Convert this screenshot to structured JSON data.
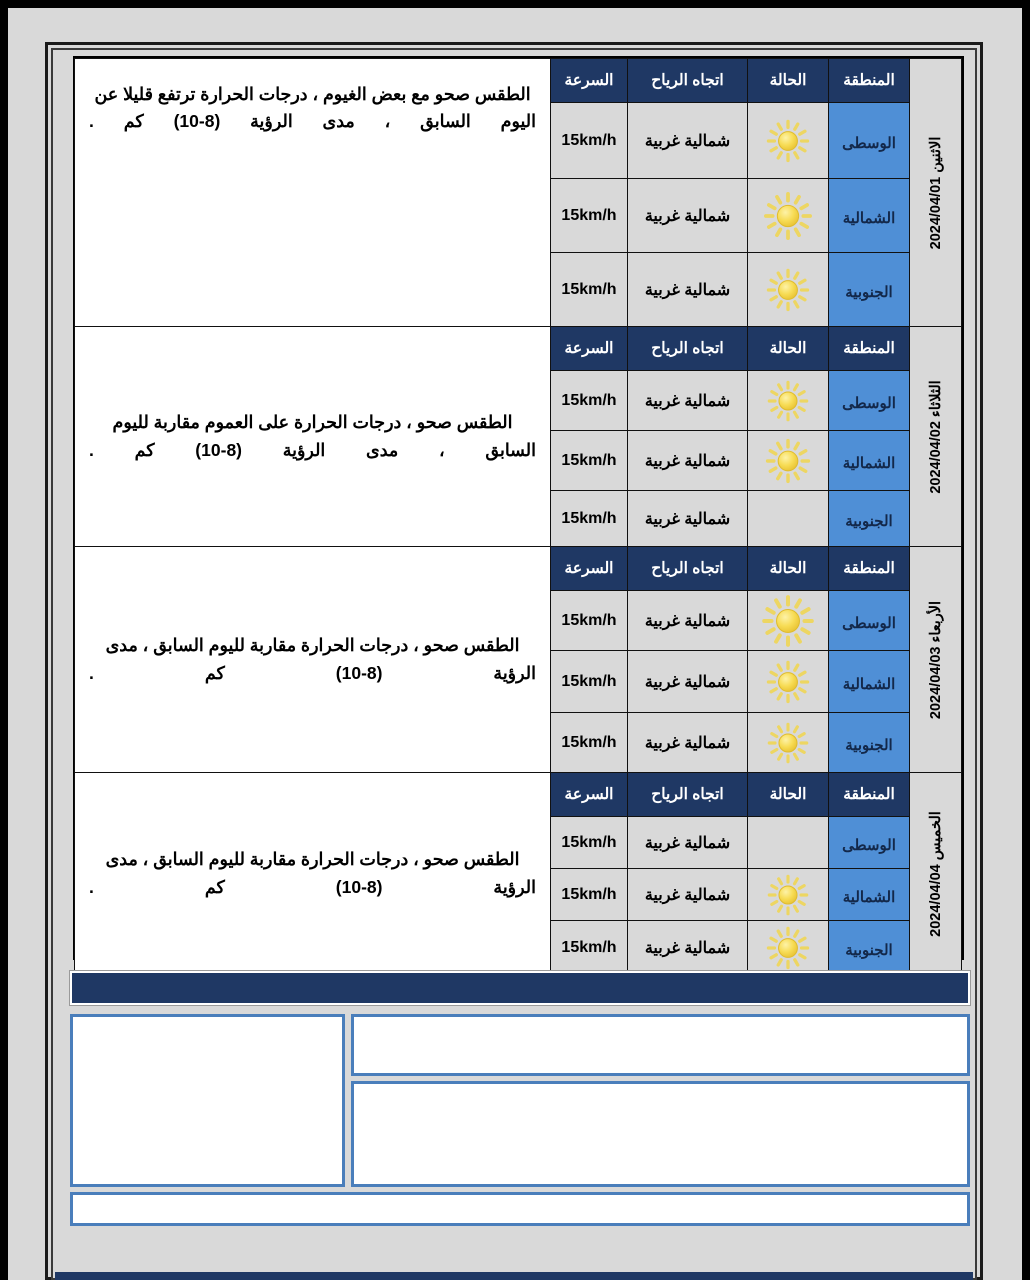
{
  "table": {
    "headers": {
      "region": "المنطقة",
      "condition": "الحالة",
      "wind_direction": "اتجاه الرياح",
      "speed": "السرعة"
    },
    "groups": [
      {
        "date": "الاثنين 2024/04/01",
        "summary": "الطقس صحو مع بعض الغيوم ، درجات الحرارة ترتفع قليلا عن اليوم السابق ، مدى الرؤية (8-10) كم .",
        "rows": [
          {
            "region": "الوسطى",
            "condition": "sun-icon",
            "wind_direction": "شمالية غربية",
            "speed": "15km/h"
          },
          {
            "region": "الشمالية",
            "condition": "sun-icon",
            "wind_direction": "شمالية غربية",
            "speed": "15km/h"
          },
          {
            "region": "الجنوبية",
            "condition": "sun-icon",
            "wind_direction": "شمالية غربية",
            "speed": "15km/h"
          }
        ]
      },
      {
        "date": "الثلاثاء 2024/04/02",
        "summary": "الطقس صحو  ، درجات الحرارة على العموم مقاربة لليوم السابق ، مدى الرؤية (8-10) كم .",
        "rows": [
          {
            "region": "الوسطى",
            "condition": "sun-icon",
            "wind_direction": "شمالية غربية",
            "speed": "15km/h"
          },
          {
            "region": "الشمالية",
            "condition": "sun-icon",
            "wind_direction": "شمالية غربية",
            "speed": "15km/h"
          },
          {
            "region": "الجنوبية",
            "condition": "",
            "wind_direction": "شمالية غربية",
            "speed": "15km/h"
          }
        ]
      },
      {
        "date": "الأربعاء 2024/04/03",
        "summary": "الطقس صحو  ، درجات الحرارة مقاربة  لليوم السابق ، مدى الرؤية (8-10) كم .",
        "rows": [
          {
            "region": "الوسطى",
            "condition": "sun-icon",
            "wind_direction": "شمالية غربية",
            "speed": "15km/h"
          },
          {
            "region": "الشمالية",
            "condition": "sun-icon",
            "wind_direction": "شمالية غربية",
            "speed": "15km/h"
          },
          {
            "region": "الجنوبية",
            "condition": "sun-icon",
            "wind_direction": "شمالية غربية",
            "speed": "15km/h"
          }
        ]
      },
      {
        "date": "الخميس 2024/04/04",
        "summary": "الطقس صحو ، درجات الحرارة مقاربة لليوم السابق ، مدى الرؤية (8-10) كم .",
        "rows": [
          {
            "region": "الوسطى",
            "condition": "",
            "wind_direction": "شمالية غربية",
            "speed": "15km/h"
          },
          {
            "region": "الشمالية",
            "condition": "sun-icon",
            "wind_direction": "شمالية غربية",
            "speed": "15km/h"
          },
          {
            "region": "الجنوبية",
            "condition": "sun-icon",
            "wind_direction": "شمالية غربية",
            "speed": "15km/h"
          }
        ]
      }
    ]
  },
  "lower_panel": {
    "banner_text": "",
    "left_box_text": "",
    "right_top_box_text": "",
    "right_bottom_box_text": "",
    "bottom_box_text": "",
    "red_chip_label": ""
  },
  "colors": {
    "header_navy": "#1f3864",
    "region_blue": "#4f8fd6",
    "cell_gray": "#d9d9d9",
    "box_border_blue": "#4a7ebb",
    "red_chip": "#c00000",
    "sun_yellow": "#f5d343"
  }
}
